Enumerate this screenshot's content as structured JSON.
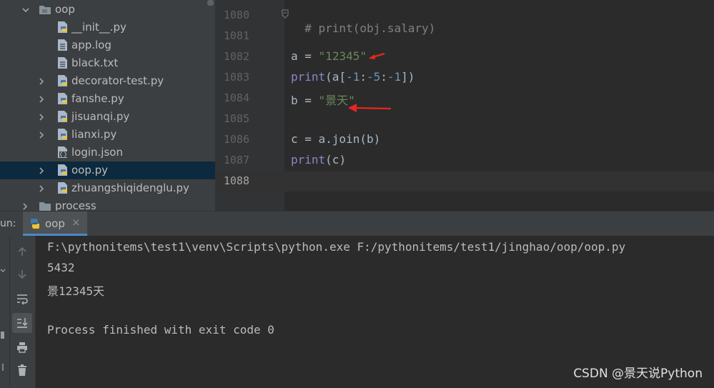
{
  "project_tree": {
    "items": [
      {
        "label": "oop",
        "type": "folder",
        "expanded": true
      },
      {
        "label": "__init__.py",
        "type": "python"
      },
      {
        "label": "app.log",
        "type": "text"
      },
      {
        "label": "black.txt",
        "type": "text"
      },
      {
        "label": "decorator-test.py",
        "type": "python"
      },
      {
        "label": "fanshe.py",
        "type": "python"
      },
      {
        "label": "jisuanqi.py",
        "type": "python"
      },
      {
        "label": "lianxi.py",
        "type": "python"
      },
      {
        "label": "login.json",
        "type": "json"
      },
      {
        "label": "oop.py",
        "type": "python",
        "selected": true
      },
      {
        "label": "zhuangshiqidenglu.py",
        "type": "python"
      },
      {
        "label": "process",
        "type": "folder",
        "expanded": false
      }
    ]
  },
  "editor": {
    "line_numbers": [
      "1080",
      "1081",
      "1082",
      "1083",
      "1084",
      "1085",
      "1086",
      "1087",
      "1088"
    ],
    "current_line": "1088",
    "code": {
      "l1080": {
        "comment": "# print(obj.salary)"
      },
      "l1082": {
        "var": "a",
        "op": " = ",
        "str": "\"12345\""
      },
      "l1083": {
        "fn": "print",
        "a": "(a[",
        "n1": "-1",
        "c1": ":",
        "n2": "-5",
        "c2": ":",
        "n3": "-1",
        "end": "])"
      },
      "l1084": {
        "var": "b",
        "op": " = ",
        "str": "\"景天\""
      },
      "l1086": {
        "text": "c = a.join(b)"
      },
      "l1087": {
        "fn": "print",
        "rest": "(c)"
      }
    }
  },
  "run_panel": {
    "label": "un:",
    "tab_label": "oop",
    "tab_close": "×",
    "console_lines": [
      "F:\\pythonitems\\test1\\venv\\Scripts\\python.exe F:/pythonitems/test1/jinghao/oop/oop.py",
      "5432",
      "景12345天",
      "",
      "Process finished with exit code 0"
    ]
  },
  "watermark": "CSDN @景天说Python",
  "colors": {
    "tree_bg": "#3c3f41",
    "selected_row": "#0d293e",
    "editor_bg": "#2b2b2b",
    "string": "#6a8759",
    "number": "#6897bb",
    "annotation_arrow": "#e8261d"
  }
}
